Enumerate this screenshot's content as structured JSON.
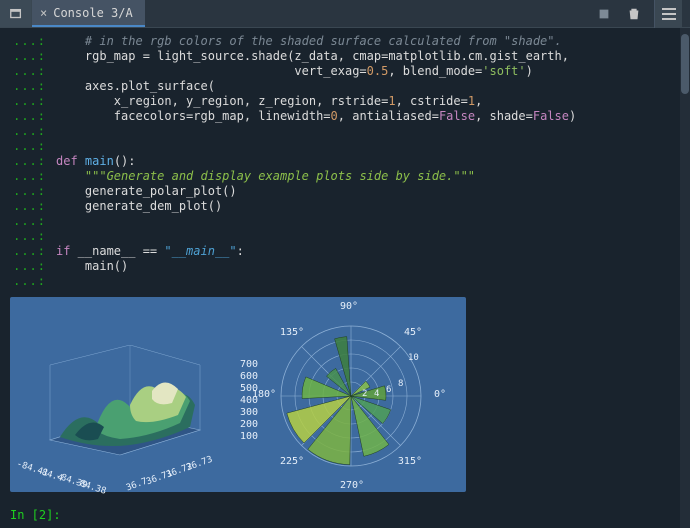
{
  "tab": {
    "label": "Console 3/A"
  },
  "code": {
    "lines": [
      {
        "g": "...:",
        "html": "    <span class='c-comment'># in the rgb colors of the shaded surface calculated from \"shade\".</span>"
      },
      {
        "g": "...:",
        "html": "    rgb_map = light_source.shade(z_data, cmap=matplotlib.cm.gist_earth,"
      },
      {
        "g": "...:",
        "html": "                                 vert_exag=<span class='c-num'>0.5</span>, blend_mode=<span class='c-str'>'soft'</span>)"
      },
      {
        "g": "...:",
        "html": "    axes.plot_surface("
      },
      {
        "g": "...:",
        "html": "        x_region, y_region, z_region, rstride=<span class='c-num'>1</span>, cstride=<span class='c-num'>1</span>,"
      },
      {
        "g": "...:",
        "html": "        facecolors=rgb_map, linewidth=<span class='c-num'>0</span>, antialiased=<span class='c-false'>False</span>, shade=<span class='c-false'>False</span>)"
      },
      {
        "g": "...:",
        "html": ""
      },
      {
        "g": "...:",
        "html": ""
      },
      {
        "g": "...:",
        "html": "<span class='c-kw'>def</span> <span class='c-func'>main</span>():"
      },
      {
        "g": "...:",
        "html": "    <span class='c-docstring'>\"\"\"Generate and display example plots side by side.\"\"\"</span>"
      },
      {
        "g": "...:",
        "html": "    generate_polar_plot()"
      },
      {
        "g": "...:",
        "html": "    generate_dem_plot()"
      },
      {
        "g": "...:",
        "html": ""
      },
      {
        "g": "...:",
        "html": ""
      },
      {
        "g": "...:",
        "html": "<span class='c-kw'>if</span> __name__ == <span class='c-ident'>\"__main__\"</span>:"
      },
      {
        "g": "...:",
        "html": "    main()"
      },
      {
        "g": "...:",
        "html": ""
      }
    ]
  },
  "prompt": {
    "label": "In [",
    "num": "2",
    "tail": "]:"
  },
  "chart_data": [
    {
      "type": "surface3d",
      "title": "",
      "x_ticks": [
        -84.41,
        -84.4,
        -84.39,
        -84.38
      ],
      "y_ticks": [
        36.7,
        36.71,
        36.72,
        36.73
      ],
      "z_ticks": [
        100,
        200,
        300,
        400,
        500,
        600,
        700
      ],
      "z_range": [
        100,
        700
      ],
      "description": "Shaded DEM terrain with gist_earth colormap"
    },
    {
      "type": "polar-bar",
      "angle_labels_deg": [
        0,
        45,
        90,
        135,
        180,
        225,
        270,
        315
      ],
      "radial_ticks": [
        2,
        4,
        6,
        8,
        10
      ],
      "r_max": 10,
      "bars": [
        {
          "theta_deg": 5,
          "width_deg": 24,
          "r": 5.0,
          "color": "#5fa03c"
        },
        {
          "theta_deg": 35,
          "width_deg": 20,
          "r": 3.0,
          "color": "#8abf4a"
        },
        {
          "theta_deg": 100,
          "width_deg": 12,
          "r": 8.5,
          "color": "#3d7f3d"
        },
        {
          "theta_deg": 130,
          "width_deg": 22,
          "r": 4.5,
          "color": "#48904e"
        },
        {
          "theta_deg": 170,
          "width_deg": 26,
          "r": 7.0,
          "color": "#6cb344"
        },
        {
          "theta_deg": 210,
          "width_deg": 30,
          "r": 9.5,
          "color": "#b5cf44"
        },
        {
          "theta_deg": 250,
          "width_deg": 38,
          "r": 9.8,
          "color": "#7db442"
        },
        {
          "theta_deg": 295,
          "width_deg": 26,
          "r": 8.8,
          "color": "#6eb34a"
        },
        {
          "theta_deg": 330,
          "width_deg": 22,
          "r": 6.0,
          "color": "#4f9f58"
        }
      ]
    }
  ]
}
